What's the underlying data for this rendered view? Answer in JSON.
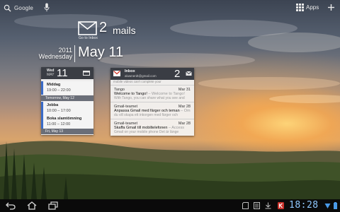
{
  "search": {
    "label": "Google",
    "icon": "search-icon"
  },
  "apps": {
    "label": "Apps"
  },
  "gmail_widget": {
    "count": "2",
    "unit": "mails",
    "link": "Go to Inbox"
  },
  "clock": {
    "year": "2011",
    "weekday": "Wednesday",
    "date": "May 11"
  },
  "calendar": {
    "head_day": "Wed",
    "head_month": "MAY",
    "head_num": "11",
    "events": [
      {
        "title": "Middag",
        "time": "19:00 – 22:00"
      },
      {
        "title": "Jobba",
        "time": "10:00 – 17:00"
      },
      {
        "title": "Boka slamtömning",
        "time": "11:00 – 12:00"
      }
    ],
    "day_bars": [
      "Tomorrow, May 12",
      "Fri, May 13"
    ]
  },
  "inbox": {
    "title": "Inbox",
    "account": "aluwnerdt@gmail.com",
    "count": "2",
    "cut_text": "mobile videos can't complete your",
    "mails": [
      {
        "sender": "Tango",
        "date": "Mar 31",
        "subject": "Welcome to Tango!",
        "snippet": " – Welcome to Tango!",
        "preview": "With Tango, you can share what you see and"
      },
      {
        "sender": "Gmail-teamet",
        "date": "Mar 28",
        "subject": "Anpassa Gmail med färger och teman",
        "snippet": " – Om",
        "preview": "du vill skapa ett inkorgen med färger och"
      },
      {
        "sender": "Gmail-teamet",
        "date": "Mar 28",
        "subject": "Skaffa Gmail till mobiltelefonen",
        "snippet": " – Access",
        "preview": "Gmail on your mobile phone Det är länge"
      }
    ]
  },
  "system": {
    "time": "18:28"
  },
  "colors": {
    "status_clock": "#8fc8ff",
    "accent_event": "#3a6cc8",
    "widget_header": "#3a3d44"
  }
}
